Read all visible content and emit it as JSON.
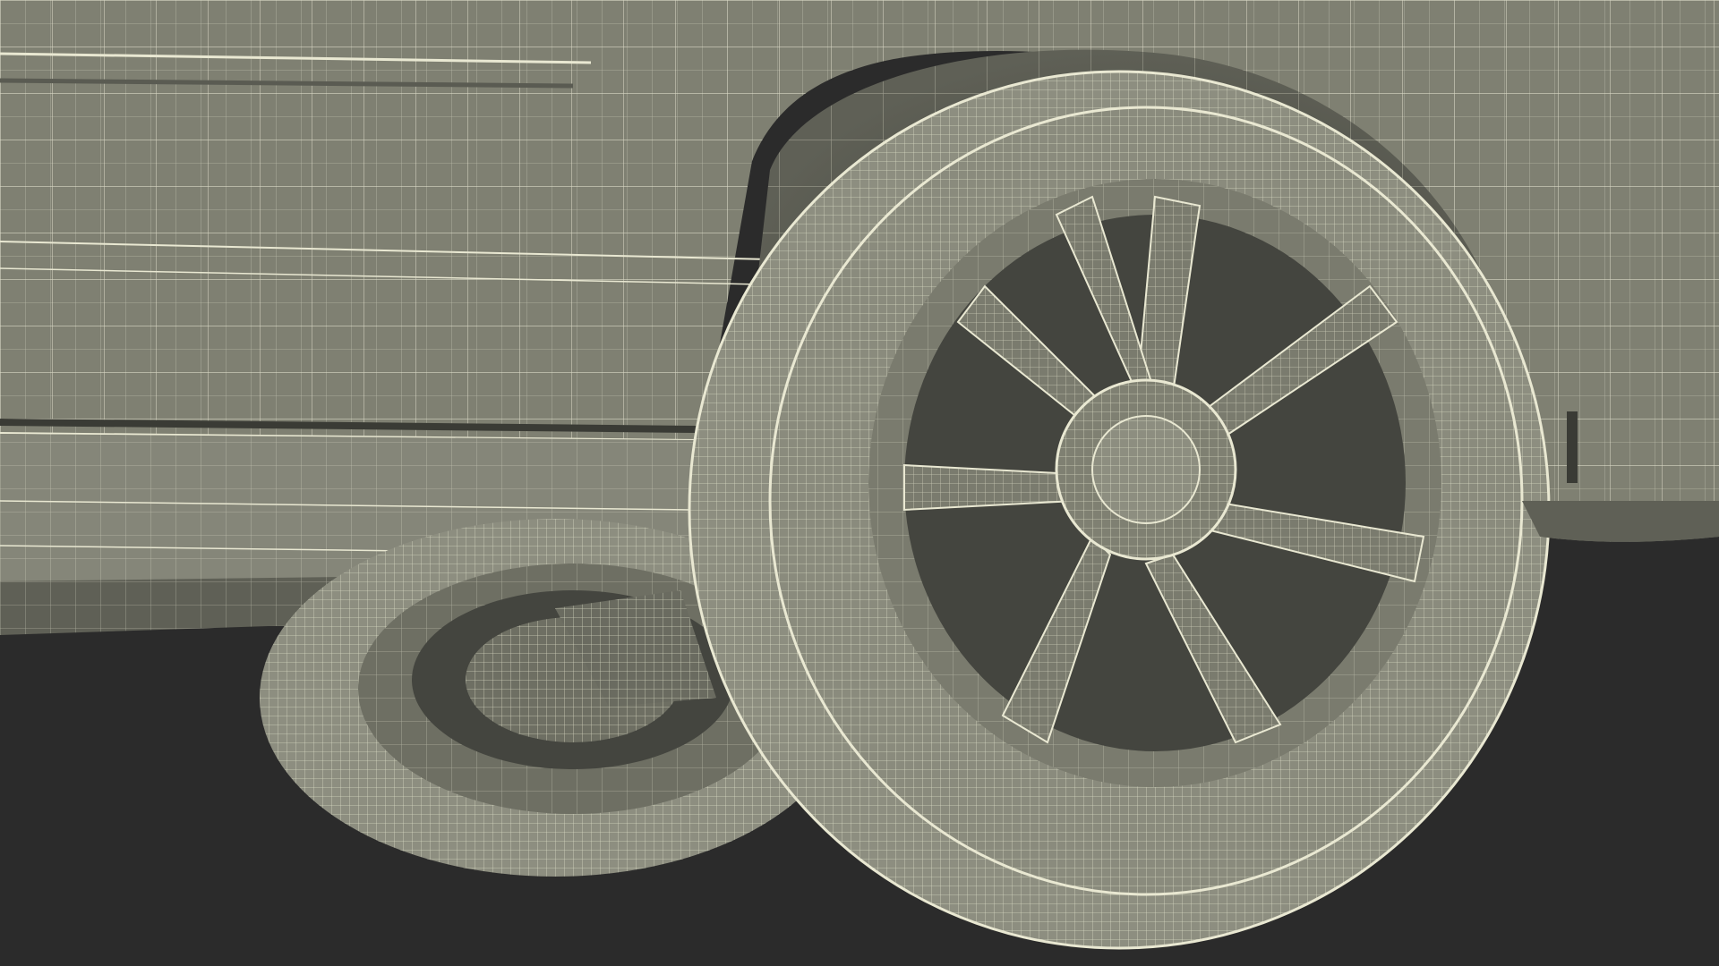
{
  "scene": {
    "subject": "wireframe-render-car-wheels",
    "colors": {
      "background": "#2b2b2b",
      "body_fill": "#7f8072",
      "body_shadow": "#5f6056",
      "body_dark": "#4f5048",
      "wire": "#e9e8d2",
      "tire_fill": "#8d8e80",
      "rim_fill": "#6e6f63",
      "hole_fill": "#44453f"
    },
    "icons": {
      "front_wheel": "wheel-icon",
      "rear_wheel": "wheel-icon"
    }
  }
}
